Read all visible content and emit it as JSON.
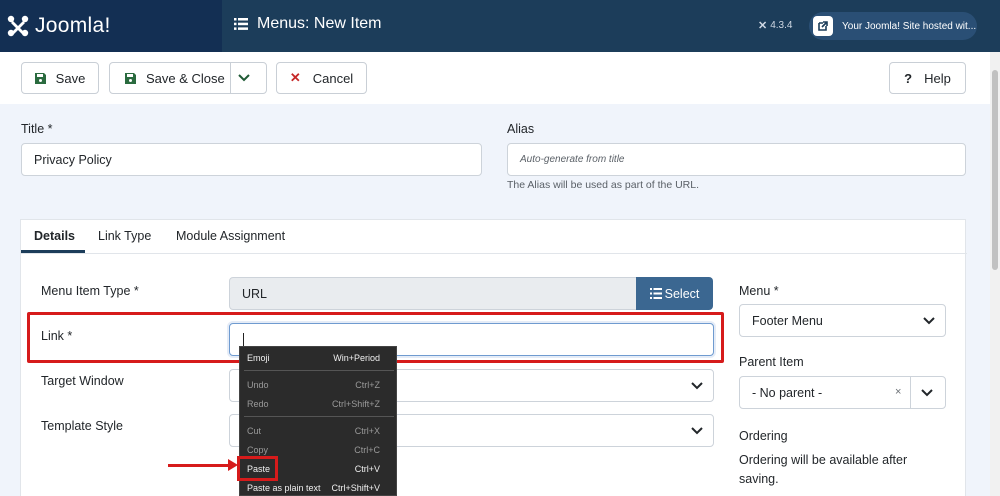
{
  "header": {
    "brand": "Joomla!",
    "page_title": "Menus: New Item",
    "version": "4.3.4",
    "hosted_label": "Your Joomla! Site hosted wit..."
  },
  "toolbar": {
    "save_label": "Save",
    "save_close_label": "Save & Close",
    "cancel_label": "Cancel",
    "help_label": "Help"
  },
  "form": {
    "title_label": "Title *",
    "title_value": "Privacy Policy",
    "alias_label": "Alias",
    "alias_placeholder": "Auto-generate from title",
    "alias_hint": "The Alias will be used as part of the URL."
  },
  "tabs": [
    "Details",
    "Link Type",
    "Module Assignment"
  ],
  "details": {
    "menu_item_type_label": "Menu Item Type *",
    "menu_item_type_value": "URL",
    "select_label": "Select",
    "link_label": "Link *",
    "link_value": "",
    "target_window_label": "Target Window",
    "template_style_label": "Template Style"
  },
  "sidebar": {
    "menu_label": "Menu *",
    "menu_value": "Footer Menu",
    "parent_label": "Parent Item",
    "parent_value": "- No parent -",
    "ordering_label": "Ordering",
    "ordering_text": "Ordering will be available after saving."
  },
  "context_menu": {
    "items": [
      {
        "label": "Emoji",
        "shortcut": "Win+Period"
      },
      {
        "label": "Undo",
        "shortcut": "Ctrl+Z"
      },
      {
        "label": "Redo",
        "shortcut": "Ctrl+Shift+Z"
      },
      {
        "label": "Cut",
        "shortcut": "Ctrl+X"
      },
      {
        "label": "Copy",
        "shortcut": "Ctrl+C"
      },
      {
        "label": "Paste",
        "shortcut": "Ctrl+V"
      },
      {
        "label": "Paste as plain text",
        "shortcut": "Ctrl+Shift+V"
      }
    ]
  },
  "colors": {
    "header_bg": "#1c3d5a",
    "brand_bg": "#132f53",
    "accent": "#3b6791",
    "highlight": "#d61b1b"
  }
}
